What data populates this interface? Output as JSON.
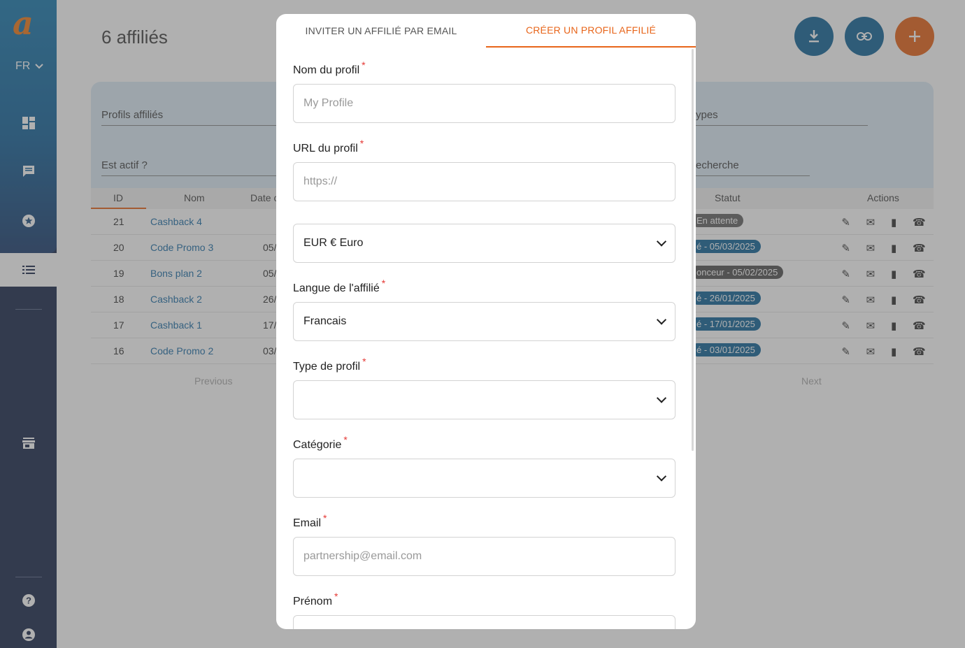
{
  "sidebar": {
    "logo": "a",
    "language": "FR"
  },
  "page": {
    "title": "6 affiliés"
  },
  "filters": {
    "profils": "Profils affiliés",
    "actif": "Est actif ?",
    "types": "ypes",
    "search": "echerche"
  },
  "table": {
    "headers": [
      "ID",
      "Nom",
      "Date c",
      "Statut",
      "Actions"
    ],
    "rows": [
      {
        "id": "21",
        "name": "Cashback 4",
        "date": "",
        "status": "En attente"
      },
      {
        "id": "20",
        "name": "Code Promo 3",
        "date": "05/",
        "status": "é - 05/03/2025"
      },
      {
        "id": "19",
        "name": "Bons plan 2",
        "date": "05/",
        "status": "onceur - 05/02/2025"
      },
      {
        "id": "18",
        "name": "Cashback 2",
        "date": "26/",
        "status": "é - 26/01/2025"
      },
      {
        "id": "17",
        "name": "Cashback 1",
        "date": "17/",
        "status": "é - 17/01/2025"
      },
      {
        "id": "16",
        "name": "Code Promo 2",
        "date": "03/",
        "status": "é - 03/01/2025"
      }
    ],
    "previous": "Previous",
    "next": "Next"
  },
  "modal": {
    "tab_invite": "INVITER UN AFFILIÉ PAR EMAIL",
    "tab_create": "CRÉER UN PROFIL AFFILIÉ",
    "fields": {
      "profile_name": {
        "label": "Nom du profil",
        "placeholder": "My Profile"
      },
      "profile_url": {
        "label": "URL du profil",
        "placeholder": "https://"
      },
      "currency": {
        "value": "EUR € Euro"
      },
      "language": {
        "label": "Langue de l'affilié",
        "value": "Francais"
      },
      "profile_type": {
        "label": "Type de profil",
        "value": ""
      },
      "category": {
        "label": "Catégorie",
        "value": ""
      },
      "email": {
        "label": "Email",
        "placeholder": "partnership@email.com"
      },
      "firstname": {
        "label": "Prénom"
      }
    },
    "required_mark": "*"
  },
  "colors": {
    "accent": "#e8651a",
    "primary": "#15679a",
    "sidebar": "#1d2b4d"
  }
}
